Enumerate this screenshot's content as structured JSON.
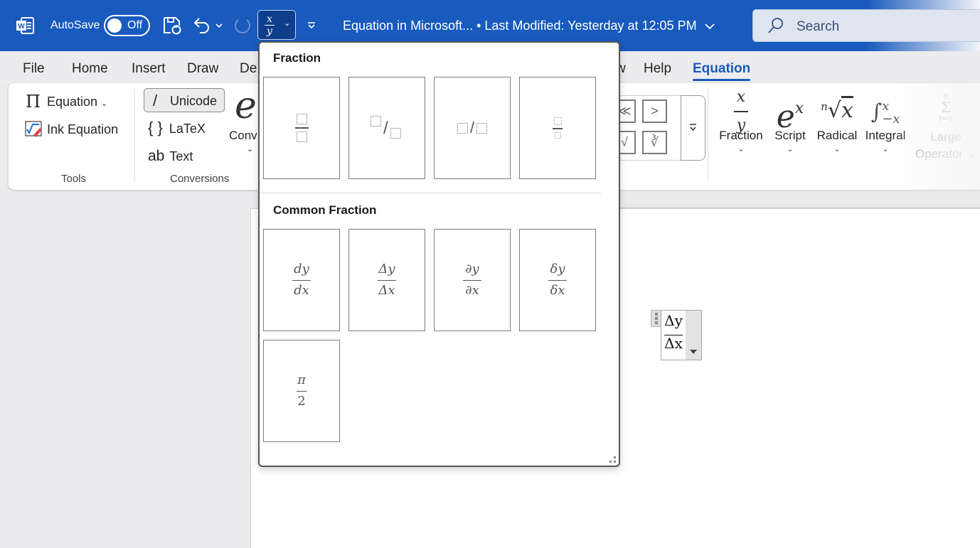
{
  "titlebar": {
    "app_icon": "word-logo-icon",
    "autosave_label": "AutoSave",
    "autosave_state": "Off",
    "quick_access": [
      "save-sync-icon",
      "undo-icon",
      "undo-dropdown-icon",
      "redo-icon",
      "equation-fraction-icon",
      "customize-toolbar-icon"
    ],
    "doc_title": "Equation in Microsoft...  • Last Modified: Yesterday at 12:05 PM",
    "search_placeholder": "Search",
    "equation_button": {
      "numerator": "x",
      "denominator": "y"
    }
  },
  "tabs": [
    {
      "label": "File"
    },
    {
      "label": "Home"
    },
    {
      "label": "Insert"
    },
    {
      "label": "Draw"
    },
    {
      "label": "De"
    },
    {
      "label": "w"
    },
    {
      "label": "Help"
    },
    {
      "label": "Equation",
      "active": true
    }
  ],
  "ribbon": {
    "tools": {
      "equation_label": "Equation",
      "ink_equation_label": "Ink Equation",
      "group_label": "Tools"
    },
    "conversions": {
      "unicode_label": "Unicode",
      "latex_label": "LaTeX",
      "text_label": "Text",
      "convert_label": "Conv",
      "group_label": "Conversions"
    },
    "symbols_gallery": {
      "cells": [
        "≪",
        ">",
        "√",
        "∛"
      ]
    },
    "structures": [
      {
        "label": "Fraction",
        "icon": "fraction-icon",
        "enabled": true
      },
      {
        "label": "Script",
        "icon": "script-icon",
        "enabled": true
      },
      {
        "label": "Radical",
        "icon": "radical-icon",
        "enabled": true
      },
      {
        "label": "Integral",
        "icon": "integral-icon",
        "enabled": true
      },
      {
        "label": "Large Operator",
        "icon": "large-operator-icon",
        "enabled": false
      }
    ]
  },
  "dropdown": {
    "sections": [
      {
        "heading": "Fraction",
        "items": [
          {
            "name": "stacked-fraction"
          },
          {
            "name": "skewed-fraction"
          },
          {
            "name": "linear-fraction"
          },
          {
            "name": "small-fraction"
          }
        ]
      },
      {
        "heading": "Common Fraction",
        "items": [
          {
            "name": "dy-dx",
            "numerator": "dy",
            "denominator": "dx"
          },
          {
            "name": "delta-y-delta-x",
            "numerator": "Δy",
            "denominator": "Δx"
          },
          {
            "name": "partial-y-partial-x",
            "numerator": "∂y",
            "denominator": "∂x"
          },
          {
            "name": "small-delta-y-delta-x",
            "numerator": "δy",
            "denominator": "δx"
          },
          {
            "name": "pi-over-2",
            "numerator": "π",
            "denominator": "2"
          }
        ]
      }
    ]
  },
  "document": {
    "equation": {
      "numerator": "Δy",
      "denominator": "Δx"
    }
  },
  "colors": {
    "brand": "#185abd",
    "active_tab": "#185abd"
  }
}
